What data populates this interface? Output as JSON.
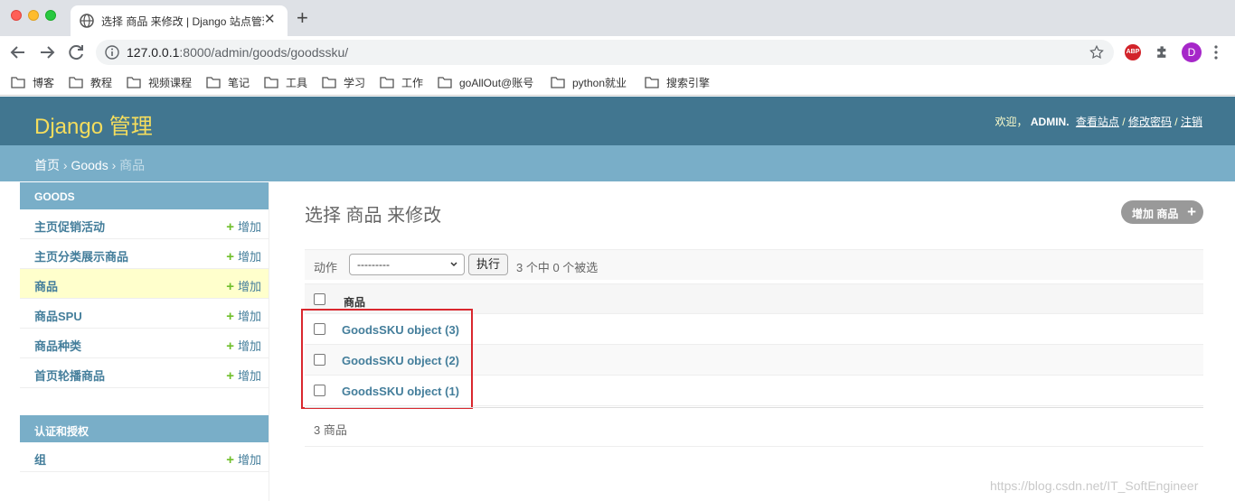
{
  "browser": {
    "tab_title": "选择 商品 来修改 | Django 站点管理员",
    "tab_close": "✕",
    "new_tab": "+",
    "url_host": "127.0.0.1",
    "url_rest": ":8000/admin/goods/goodssku/",
    "ext_abp": "ABP",
    "avatar_letter": "D",
    "bookmarks": [
      "博客",
      "教程",
      "视频课程",
      "笔记",
      "工具",
      "学习",
      "工作",
      "goAllOut@账号",
      "python就业",
      "搜索引擎"
    ]
  },
  "header": {
    "brand": "Django 管理",
    "welcome": "欢迎，",
    "username": "ADMIN.",
    "view_site": "查看站点",
    "change_password": "修改密码",
    "logout": "注销",
    "slash": "/"
  },
  "breadcrumbs": {
    "home": "首页",
    "app": "Goods",
    "model": "商品",
    "sep": "›"
  },
  "sidebar": {
    "goods": {
      "caption": "GOODS",
      "items": [
        {
          "name": "主页促销活动",
          "add": "增加"
        },
        {
          "name": "主页分类展示商品",
          "add": "增加"
        },
        {
          "name": "商品",
          "add": "增加"
        },
        {
          "name": "商品SPU",
          "add": "增加"
        },
        {
          "name": "商品种类",
          "add": "增加"
        },
        {
          "name": "首页轮播商品",
          "add": "增加"
        }
      ]
    },
    "auth": {
      "caption": "认证和授权",
      "items": [
        {
          "name": "组",
          "add": "增加"
        }
      ]
    },
    "plus": "+"
  },
  "content": {
    "title": "选择 商品 来修改",
    "add_button": "增加 商品",
    "add_plus": "+",
    "actions": {
      "label": "动作",
      "select_value": "---------",
      "go": "执行",
      "counter": "3 个中 0 个被选"
    },
    "table": {
      "header": "商品",
      "rows": [
        "GoodsSKU object (3)",
        "GoodsSKU object (2)",
        "GoodsSKU object (1)"
      ]
    },
    "paginator": "3 商品"
  },
  "watermark": "https://blog.csdn.net/IT_SoftEngineer",
  "colors": {
    "header_bg": "#417690",
    "brand": "#f5dd5d",
    "breadcrumb_bg": "#79aec8",
    "link": "#447e9b",
    "add_plus": "#70bf2b",
    "highlight_box": "#d9272e"
  }
}
